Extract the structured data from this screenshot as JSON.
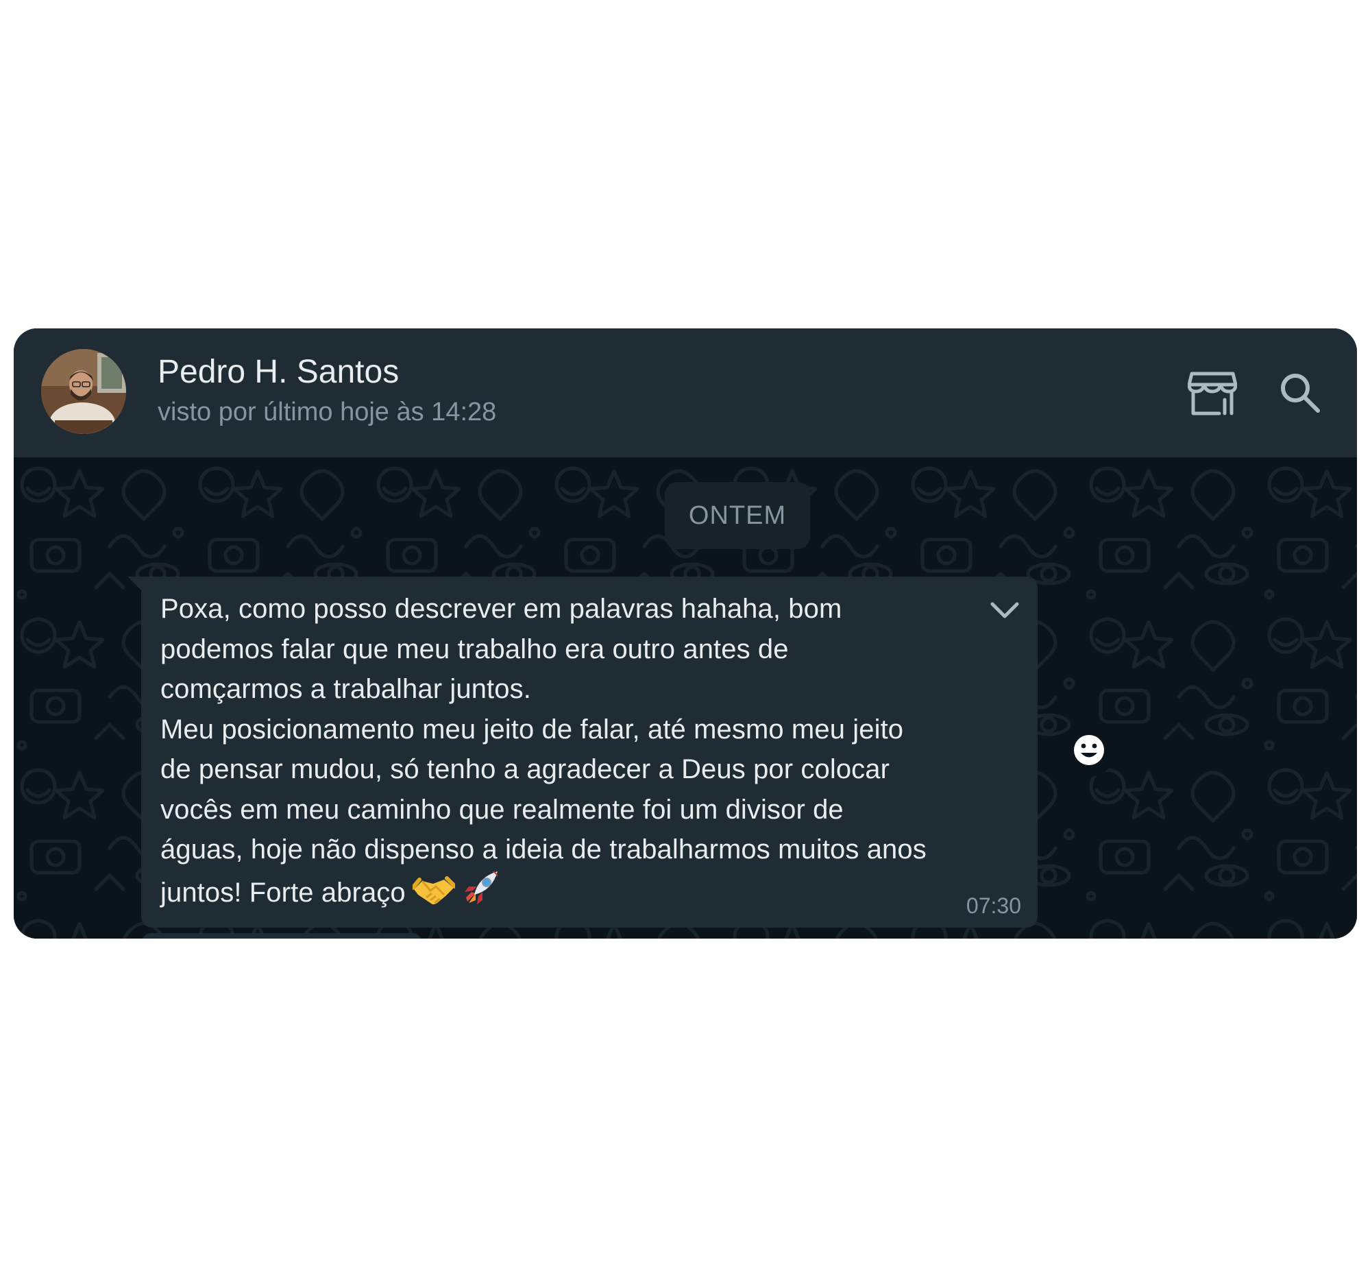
{
  "header": {
    "contact_name": "Pedro H. Santos",
    "status": "visto por último hoje às 14:28",
    "icons": [
      "avatar",
      "store-icon",
      "search-icon"
    ]
  },
  "chat": {
    "date_separator": "ONTEM",
    "message": {
      "text": "Poxa, como posso descrever em palavras hahaha, bom\npodemos falar que meu trabalho era outro antes de\ncomçarmos a trabalhar juntos.\nMeu posicionamento meu jeito de falar, até mesmo meu jeito\nde pensar mudou, só tenho a agradecer a Deus por colocar\nvocês em meu caminho que realmente foi um divisor de\náguas, hoje não dispenso a ideia de trabalharmos muitos anos\njuntos! Forte abraço",
      "emojis": [
        "handshake-emoji",
        "rocket-emoji"
      ],
      "time": "07:30",
      "menu_icon": "chevron-down-icon"
    },
    "reaction_icon": "smiley-icon"
  },
  "colors": {
    "header_bg": "#202c33",
    "chat_bg": "#0b141a",
    "bubble_bg": "#202c33",
    "primary_text": "#e9edef",
    "secondary_text": "#8696a0",
    "date_chip_bg": "#182229"
  }
}
